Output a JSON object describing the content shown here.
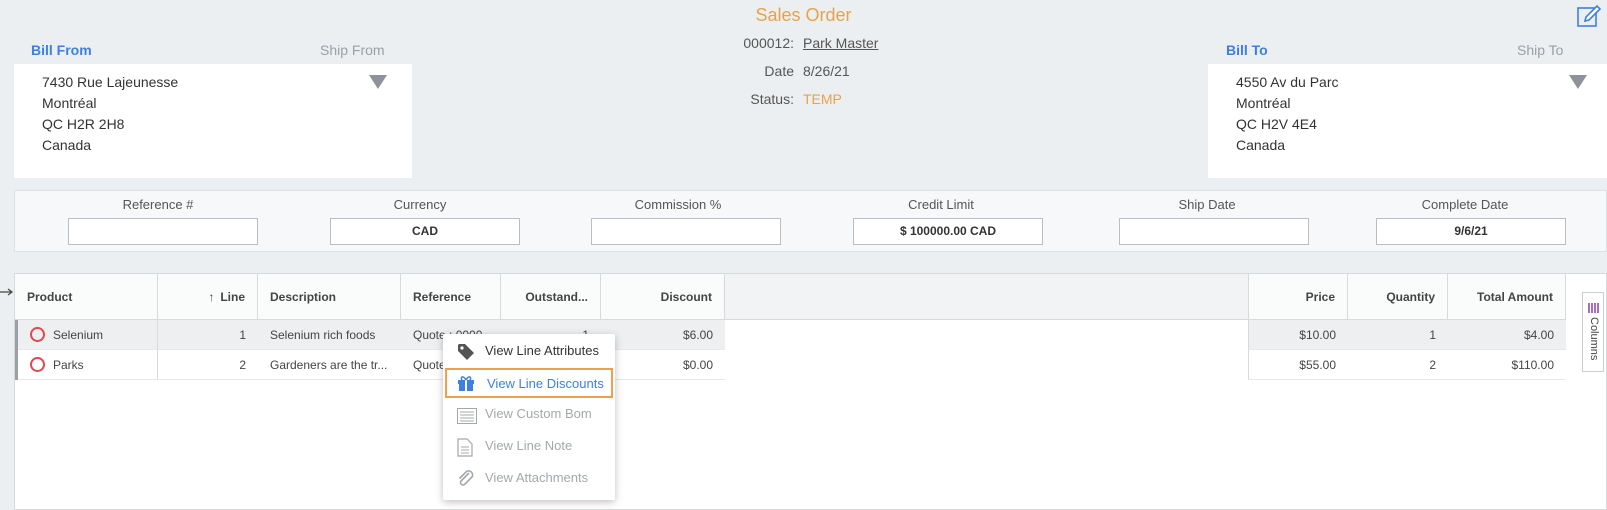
{
  "header": {
    "title": "Sales Order",
    "order_number": "000012:",
    "customer_name": "Park Master",
    "date_label": "Date",
    "date_value": "8/26/21",
    "status_label": "Status:",
    "status_value": "TEMP"
  },
  "bill_from": {
    "tab_active": "Bill From",
    "tab_inactive": "Ship From",
    "lines": [
      "7430 Rue Lajeunesse",
      "Montréal",
      "QC H2R 2H8",
      "Canada"
    ]
  },
  "bill_to": {
    "tab_active": "Bill To",
    "tab_inactive": "Ship To",
    "lines": [
      "4550 Av du Parc",
      "Montréal",
      "QC H2V 4E4",
      "Canada"
    ]
  },
  "fields": [
    {
      "label": "Reference #",
      "value": ""
    },
    {
      "label": "Currency",
      "value": "CAD"
    },
    {
      "label": "Commission %",
      "value": ""
    },
    {
      "label": "Credit Limit",
      "value": "$ 100000.00 CAD"
    },
    {
      "label": "Ship Date",
      "value": ""
    },
    {
      "label": "Complete Date",
      "value": "9/6/21"
    }
  ],
  "grid": {
    "columns": {
      "product": "Product",
      "line": "Line",
      "description": "Description",
      "reference": "Reference",
      "outstanding": "Outstand...",
      "discount": "Discount",
      "price": "Price",
      "quantity": "Quantity",
      "total": "Total Amount"
    },
    "sort_indicator": "↑",
    "rows": [
      {
        "product": "Selenium",
        "line": "1",
        "description": "Selenium rich foods",
        "reference": "Quote : 0000",
        "outstanding": "1",
        "discount": "$6.00",
        "price": "$10.00",
        "quantity": "1",
        "total": "$4.00"
      },
      {
        "product": "Parks",
        "line": "2",
        "description": "Gardeners are the tr...",
        "reference": "Quote",
        "outstanding": "",
        "discount": "$0.00",
        "price": "$55.00",
        "quantity": "2",
        "total": "$110.00"
      }
    ],
    "columns_tab_label": "Columns"
  },
  "context_menu": {
    "items": [
      {
        "label": "View Line Attributes",
        "icon": "tag-icon",
        "state": "enabled"
      },
      {
        "label": "View Line Discounts",
        "icon": "gift-icon",
        "state": "highlighted"
      },
      {
        "label": "View Custom Bom",
        "icon": "list-icon",
        "state": "disabled"
      },
      {
        "label": "View Line Note",
        "icon": "document-icon",
        "state": "disabled"
      },
      {
        "label": "View Attachments",
        "icon": "paperclip-icon",
        "state": "disabled"
      }
    ]
  },
  "colors": {
    "title": "#e8a24a",
    "accent": "#3d7fe3",
    "status": "#e8a24a",
    "highlight_border": "#f0a04b",
    "row_status_ring": "#e0484e"
  }
}
